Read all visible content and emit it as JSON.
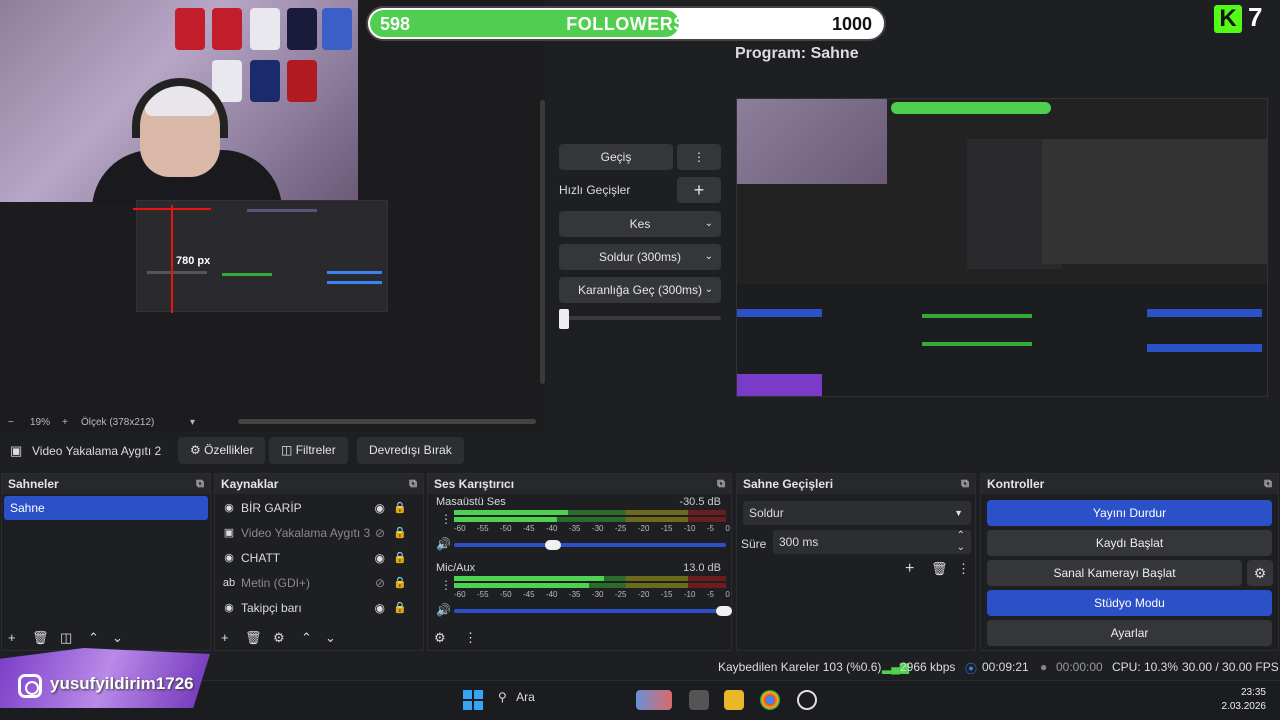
{
  "followers": {
    "current": "598",
    "label": "FOLLOWERS",
    "goal": "1000",
    "progress_fraction": 0.598
  },
  "kick": {
    "logo": "K",
    "count": "7"
  },
  "program_label": "Program: Sahne",
  "preview": {
    "px_label": "780 px",
    "zoom_minus": "−",
    "zoom_percent": "19%",
    "zoom_plus": "+",
    "scale_label": "Ölçek (378x212)",
    "scale_arrow": "▾"
  },
  "transitions_panel": {
    "gecis": "Geçiş",
    "menu_dots": "⋮",
    "hizli_gecisler": "Hızlı Geçişler",
    "plus": "+",
    "kes": "Kes",
    "soldur": "Soldur (300ms)",
    "karanliga": "Karanlığa Geç (300ms)"
  },
  "source_toolbar": {
    "source_name": "Video Yakalama Aygıtı 2",
    "properties": "Özellikler",
    "filters": "Filtreler",
    "deactivate": "Devredışı Bırak"
  },
  "docks": {
    "scenes": {
      "title": "Sahneler",
      "items": [
        "Sahne"
      ]
    },
    "sources": {
      "title": "Kaynaklar",
      "items": [
        {
          "label": "BİR GARİP",
          "icon": "globe-icon",
          "glyph": "◉",
          "hidden": false
        },
        {
          "label": "Video Yakalama Aygıtı 3",
          "icon": "camera-icon",
          "glyph": "▣",
          "hidden": true
        },
        {
          "label": "CHATT",
          "icon": "globe-icon",
          "glyph": "◉",
          "hidden": false
        },
        {
          "label": "Metin (GDI+)",
          "icon": "text-icon",
          "glyph": "ab",
          "hidden": true
        },
        {
          "label": "Takipçi barı",
          "icon": "globe-icon",
          "glyph": "◉",
          "hidden": false
        }
      ]
    },
    "mixer": {
      "title": "Ses Karıştırıcı",
      "ticks": [
        "-60",
        "-55",
        "-50",
        "-45",
        "-40",
        "-35",
        "-30",
        "-25",
        "-20",
        "-15",
        "-10",
        "-5",
        "0"
      ],
      "channels": [
        {
          "name": "Masaüstü Ses",
          "db": "-30.5 dB",
          "level_fraction": 0.42,
          "volume_fraction": 0.37
        },
        {
          "name": "Mic/Aux",
          "db": "13.0 dB",
          "level_fraction": 0.55,
          "volume_fraction": 1.0
        }
      ]
    },
    "transitions": {
      "title": "Sahne Geçişleri",
      "selected": "Soldur",
      "duration_label": "Süre",
      "duration_value": "300 ms"
    },
    "controls": {
      "title": "Kontroller",
      "stop_stream": "Yayını Durdur",
      "start_record": "Kaydı Başlat",
      "virtual_cam": "Sanal Kamerayı Başlat",
      "studio_mode": "Stüdyo Modu",
      "settings": "Ayarlar"
    }
  },
  "status": {
    "dropped": "Kaybedilen Kareler 103 (%0.6)",
    "bitrate": "2966 kbps",
    "stream_time": "00:09:21",
    "record_time": "00:00:00",
    "cpu": "CPU: 10.3%",
    "fps": "30.00 / 30.00 FPS"
  },
  "overlay": {
    "instagram_handle": "yusufyildirim1726"
  },
  "taskbar": {
    "search": "Ara",
    "time": "23:35",
    "date": "2.03.2026"
  },
  "colors": {
    "accent": "#2b50c8",
    "kick_green": "#53fc18",
    "bar_green": "#4fce4f"
  }
}
